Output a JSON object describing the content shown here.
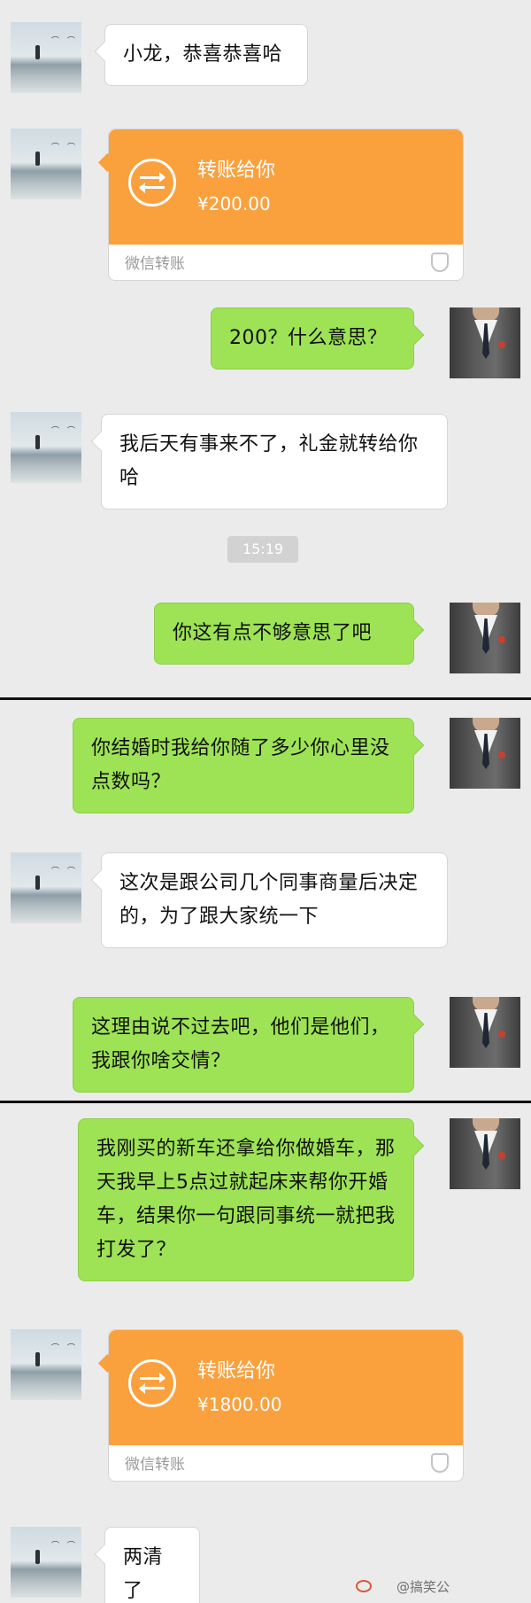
{
  "screen1": {
    "messages": [
      {
        "text": "小龙，恭喜恭喜哈"
      },
      {
        "transfer_title": "转账给你",
        "amount": "¥200.00",
        "footer": "微信转账"
      },
      {
        "text": "200？什么意思？"
      },
      {
        "text": "我后天有事来不了，礼金就转给你哈"
      },
      {
        "time": "15:19"
      },
      {
        "text": "你这有点不够意思了吧"
      }
    ]
  },
  "screen2": {
    "messages": [
      {
        "text": "你结婚时我给你随了多少你心里没点数吗？"
      },
      {
        "text": "这次是跟公司几个同事商量后决定的，为了跟大家统一下"
      },
      {
        "text": "这理由说不过去吧，他们是他们，我跟你啥交情？"
      }
    ]
  },
  "screen3": {
    "messages": [
      {
        "text": "我刚买的新车还拿给你做婚车，那天我早上5点过就起床来帮你开婚车，结果你一句跟同事统一就把我打发了？"
      },
      {
        "transfer_title": "转账给你",
        "amount": "¥1800.00",
        "footer": "微信转账"
      },
      {
        "text": "两清了"
      }
    ]
  },
  "watermark": "@搞笑公",
  "colors": {
    "outgoing": "#9de355",
    "incoming": "#ffffff",
    "transfer": "#faa13e",
    "background": "#ebebeb"
  },
  "icons": [
    "friend-avatar",
    "my-avatar",
    "transfer-arrows-icon",
    "shield-icon",
    "weibo-icon"
  ]
}
